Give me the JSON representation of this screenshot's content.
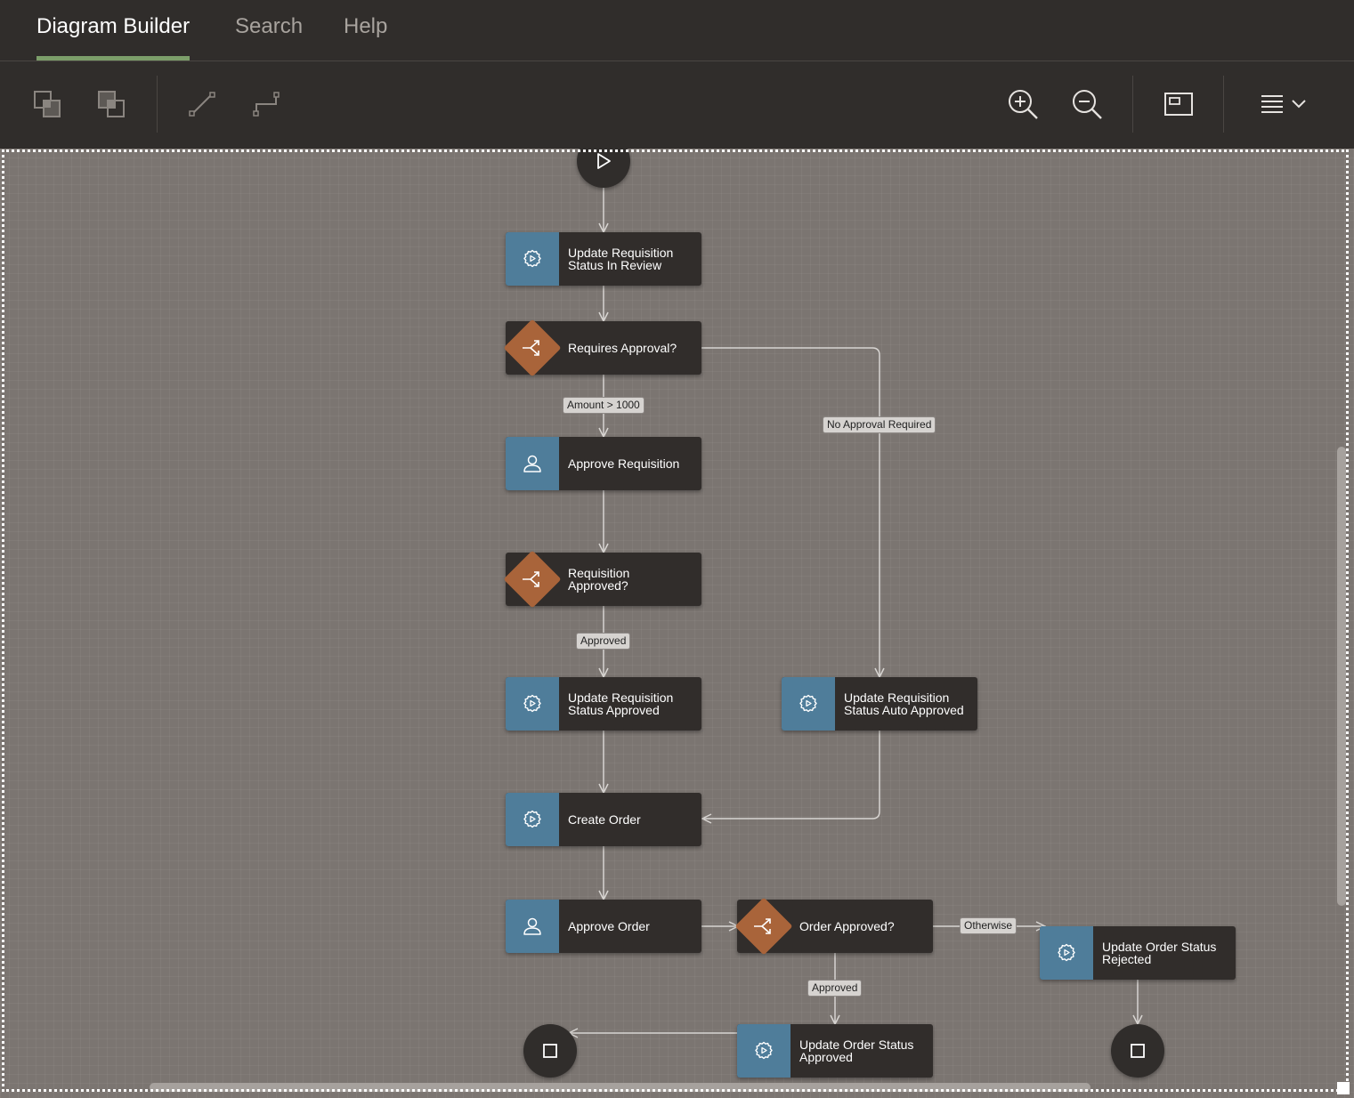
{
  "tabs": [
    {
      "label": "Diagram Builder",
      "active": true
    },
    {
      "label": "Search",
      "active": false
    },
    {
      "label": "Help",
      "active": false
    }
  ],
  "toolbar": {
    "left_icons": [
      "bring-to-front-icon",
      "send-to-back-icon",
      "straight-connector-icon",
      "elbow-connector-icon"
    ],
    "right_icons": [
      "zoom-in-icon",
      "zoom-out-icon",
      "fit-to-window-icon",
      "menu-icon"
    ]
  },
  "nodes": [
    {
      "id": "update_in_review",
      "type": "service",
      "label": "Update Requisition\nStatus In Review"
    },
    {
      "id": "requires_approval",
      "type": "gateway",
      "label": "Requires Approval?"
    },
    {
      "id": "approve_requisition",
      "type": "user",
      "label": "Approve Requisition"
    },
    {
      "id": "requisition_approved",
      "type": "gateway",
      "label": "Requisition\nApproved?"
    },
    {
      "id": "update_approved",
      "type": "service",
      "label": "Update Requisition\nStatus Approved"
    },
    {
      "id": "update_auto_approved",
      "type": "service",
      "label": "Update Requisition\nStatus Auto Approved"
    },
    {
      "id": "create_order",
      "type": "service",
      "label": "Create Order"
    },
    {
      "id": "approve_order",
      "type": "user",
      "label": "Approve Order"
    },
    {
      "id": "order_approved",
      "type": "gateway",
      "label": "Order Approved?"
    },
    {
      "id": "update_order_rejected",
      "type": "service",
      "label": "Update Order Status\nRejected"
    },
    {
      "id": "update_order_approved",
      "type": "service",
      "label": "Update Order Status\nApproved"
    }
  ],
  "edge_labels": {
    "amount": "Amount > 1000",
    "no_approval": "No Approval Required",
    "approved_1": "Approved",
    "otherwise": "Otherwise",
    "approved_2": "Approved"
  },
  "colors": {
    "canvas": "#7b7571",
    "node_body": "#312d2b",
    "task_icon_box": "#4f7d9a",
    "gateway_diamond": "#a9643a",
    "active_tab_underline": "#7c9e6a"
  }
}
